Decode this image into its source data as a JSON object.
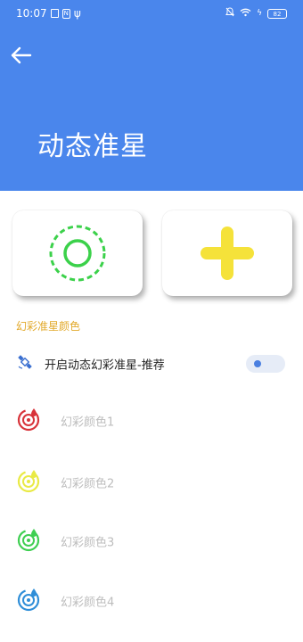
{
  "status_bar": {
    "time": "10:07",
    "battery": "82"
  },
  "header": {
    "title": "动态准星",
    "background_color": "#4a86ec"
  },
  "cards": [
    {
      "icon": "dashed-circle-crosshair-icon",
      "color": "#3bd14a"
    },
    {
      "icon": "plus-crosshair-icon",
      "color": "#f5e23a"
    }
  ],
  "section": {
    "label": "幻彩准星颜色",
    "color": "#e2a92a"
  },
  "toggle_row": {
    "icon": "satellite-icon",
    "label": "开启动态幻彩准星-推荐",
    "toggle_on": false
  },
  "color_options": [
    {
      "label": "幻彩颜色1",
      "color": "#d8333a",
      "icon": "radar-drop-icon"
    },
    {
      "label": "幻彩颜色2",
      "color": "#e9ea45",
      "icon": "radar-drop-icon"
    },
    {
      "label": "幻彩颜色3",
      "color": "#3fcf52",
      "icon": "radar-drop-icon"
    },
    {
      "label": "幻彩颜色4",
      "color": "#2f8ed8",
      "icon": "radar-drop-icon"
    }
  ]
}
